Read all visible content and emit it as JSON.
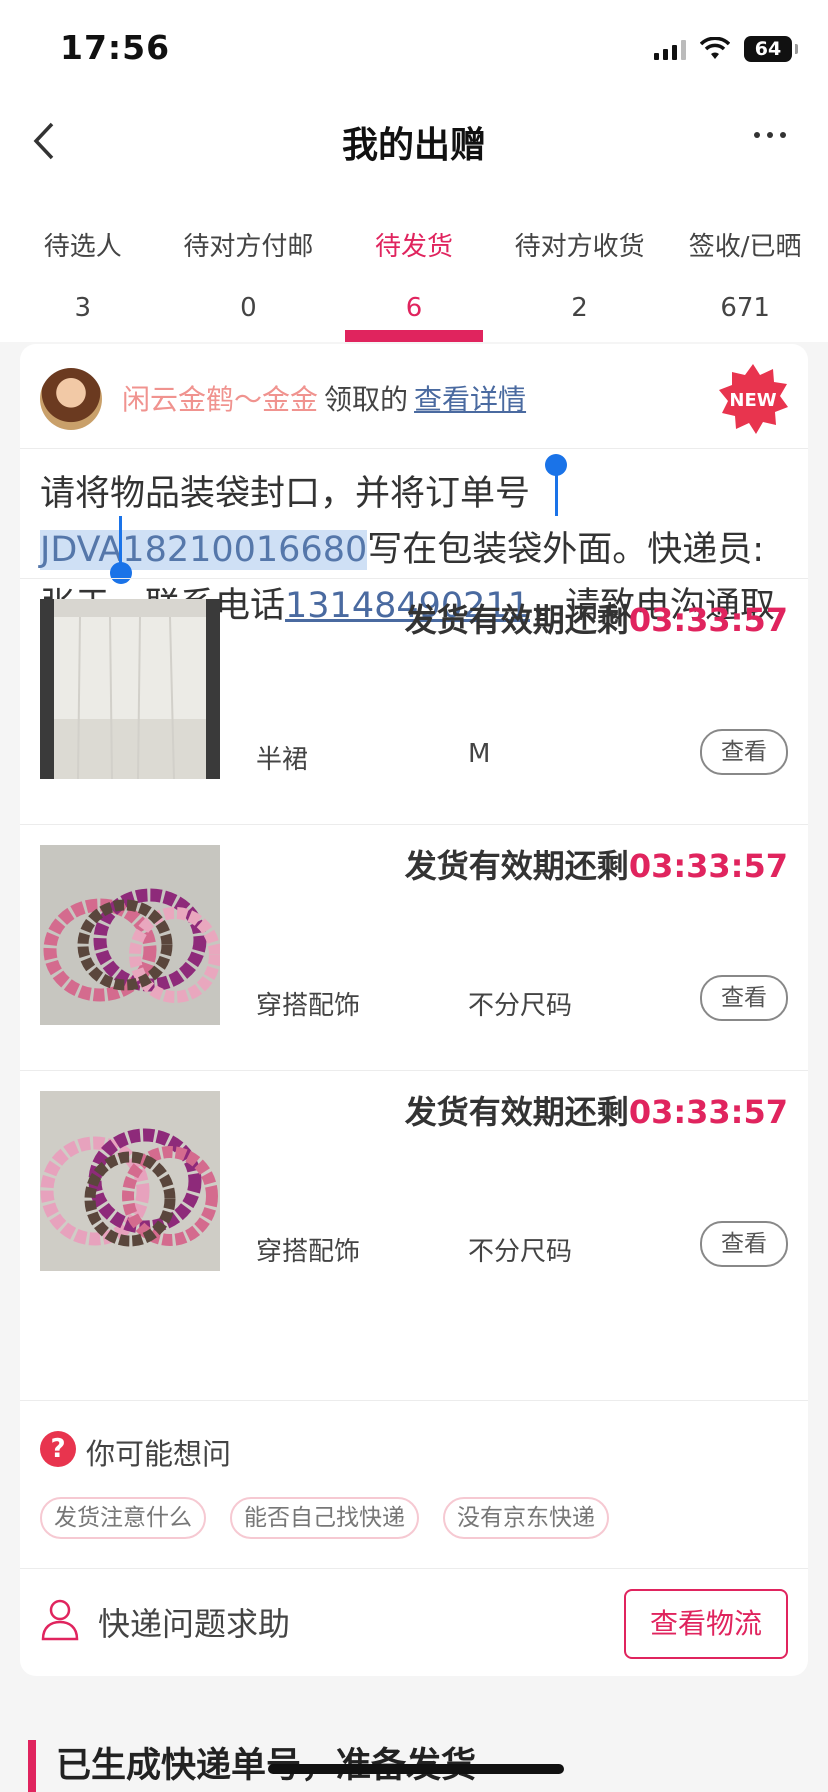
{
  "status_bar": {
    "time": "17:56",
    "battery": "64"
  },
  "nav": {
    "title": "我的出赠"
  },
  "tabs": [
    {
      "label": "待选人",
      "count": "3"
    },
    {
      "label": "待对方付邮",
      "count": "0"
    },
    {
      "label": "待发货",
      "count": "6"
    },
    {
      "label": "待对方收货",
      "count": "2"
    },
    {
      "label": "签收/已晒",
      "count": "671"
    }
  ],
  "receiver": {
    "name": "闲云金鹤～金金",
    "verb": "领取的",
    "link": "查看详情",
    "badge": "NEW"
  },
  "instruction": {
    "before": "请将物品装袋封口，并将订单号",
    "order_no": "JDVA18210016680",
    "middle": "写在包装袋外面。快递员:张于，联系电话",
    "phone": "13148490211",
    "after": "，请致电沟通取件时间。"
  },
  "items": [
    {
      "deadline_label": "发货有效期还剩",
      "deadline_time": "03:33:57",
      "name": "半裙",
      "size": "M",
      "view": "查看"
    },
    {
      "deadline_label": "发货有效期还剩",
      "deadline_time": "03:33:57",
      "name": "穿搭配饰",
      "size": "不分尺码",
      "view": "查看"
    },
    {
      "deadline_label": "发货有效期还剩",
      "deadline_time": "03:33:57",
      "name": "穿搭配饰",
      "size": "不分尺码",
      "view": "查看"
    }
  ],
  "faq": {
    "title": "你可能想问",
    "chips": [
      "发货注意什么",
      "能否自己找快递",
      "没有京东快递"
    ]
  },
  "help": {
    "label": "快递问题求助",
    "button": "查看物流"
  },
  "section": {
    "title": "已生成快递单号，准备发货"
  },
  "colors": {
    "accent": "#e0245e",
    "link": "#4a6aa0",
    "selection": "#cfe0f5"
  }
}
